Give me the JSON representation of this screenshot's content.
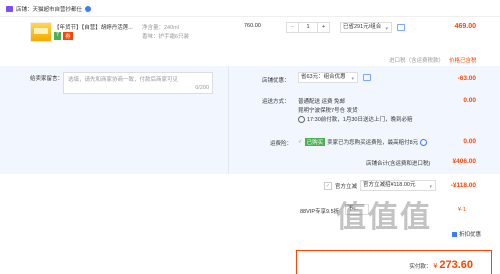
{
  "shop": {
    "label": "店铺：",
    "name": "天猫超市自营抄都仕",
    "colors": {
      "shop_icon": "#7c4dff",
      "badge": "#3b7cff"
    }
  },
  "item": {
    "title": "【年货节】【自营】胡婷丹活莲...",
    "tags": [
      "7",
      "券"
    ],
    "props": [
      "净含量：240ml",
      "香味：护手霜6只装"
    ],
    "unit_price": "760.00",
    "qty": "1",
    "minus": "−",
    "plus": "+",
    "discount_select": "已省291元/组合优...",
    "total": "469.00"
  },
  "import_row": {
    "note": "进口税（含运费税款）",
    "link": "价格已含税"
  },
  "message": {
    "label": "给卖家留言：",
    "placeholder": "选填，请先和商家协商一致，付款后商家可见",
    "counter": "0/200"
  },
  "coupon": {
    "label": "店铺优惠：",
    "select": "省63元：组合优惠",
    "amount": "-63.00"
  },
  "delivery": {
    "label": "运送方式：",
    "lines": [
      "普通配送 运费 免邮",
      "昆明宁波保税7号仓 发货",
      "17:30前付款，1月30日送达上门，晚到必赔"
    ],
    "amount": "0.00"
  },
  "tax": {
    "label": "运费险：",
    "badge": "已购买",
    "text": "卖家已为您购买运费险，最高赔付8元",
    "amount": "0.00"
  },
  "store_total": {
    "label": "店铺合计(含运费和进口税)",
    "amount": "¥406.00"
  },
  "official": {
    "checkbox": "✓",
    "label": "官方立减",
    "select": "官方立减招¥118.00元",
    "amount": "-¥118.00"
  },
  "vip": {
    "label": "88VIP专享9.5折",
    "select": "不...",
    "partial_amount": "¥-1",
    "card_label": "折扣优惠"
  },
  "pay": {
    "label": "实付款：",
    "currency": "¥",
    "amount": "273.60"
  },
  "watermark": "值值值 zhizhizhi.com"
}
